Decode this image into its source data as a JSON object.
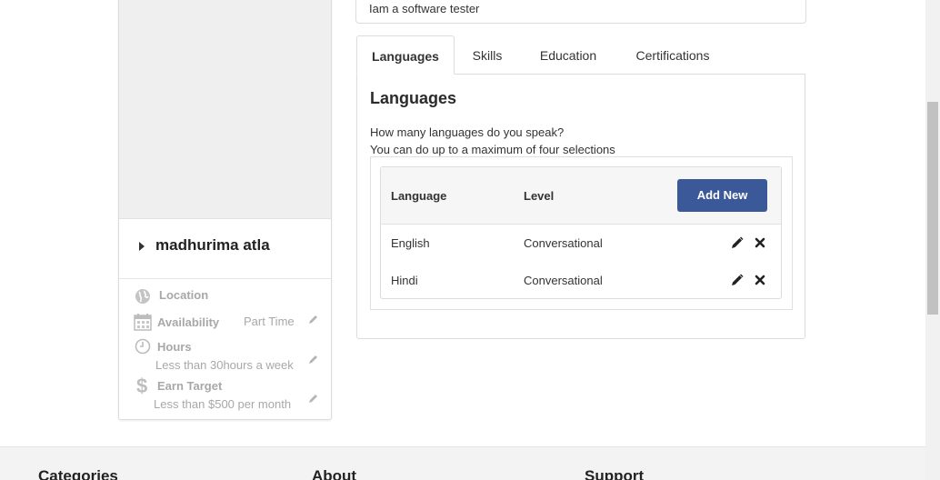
{
  "about": {
    "text": "Iam a software tester"
  },
  "profile": {
    "name": "madhurima atla",
    "location_label": "Location",
    "availability_label": "Availability",
    "availability_value": "Part Time",
    "hours_label": "Hours",
    "hours_value": "Less than 30hours a week",
    "earn_label": "Earn Target",
    "earn_value": "Less than $500 per month",
    "earn_icon": "$"
  },
  "tabs": [
    {
      "label": "Languages",
      "active": true
    },
    {
      "label": "Skills"
    },
    {
      "label": "Education"
    },
    {
      "label": "Certifications"
    }
  ],
  "languages": {
    "title": "Languages",
    "question": "How many languages do you speak?",
    "limit_note": "You can do up to a maximum of four selections",
    "col_language": "Language",
    "col_level": "Level",
    "add_button": "Add New",
    "rows": [
      {
        "language": "English",
        "level": "Conversational"
      },
      {
        "language": "Hindi",
        "level": "Conversational"
      }
    ]
  },
  "footer": {
    "categories": "Categories",
    "about": "About",
    "support": "Support"
  },
  "colors": {
    "primary_button": "#3b5998",
    "muted_text": "#a8a8a8"
  },
  "icons": [
    "globe-icon",
    "calendar-icon",
    "clock-icon",
    "dollar-icon",
    "pencil-icon",
    "close-icon",
    "caret-right-icon"
  ]
}
